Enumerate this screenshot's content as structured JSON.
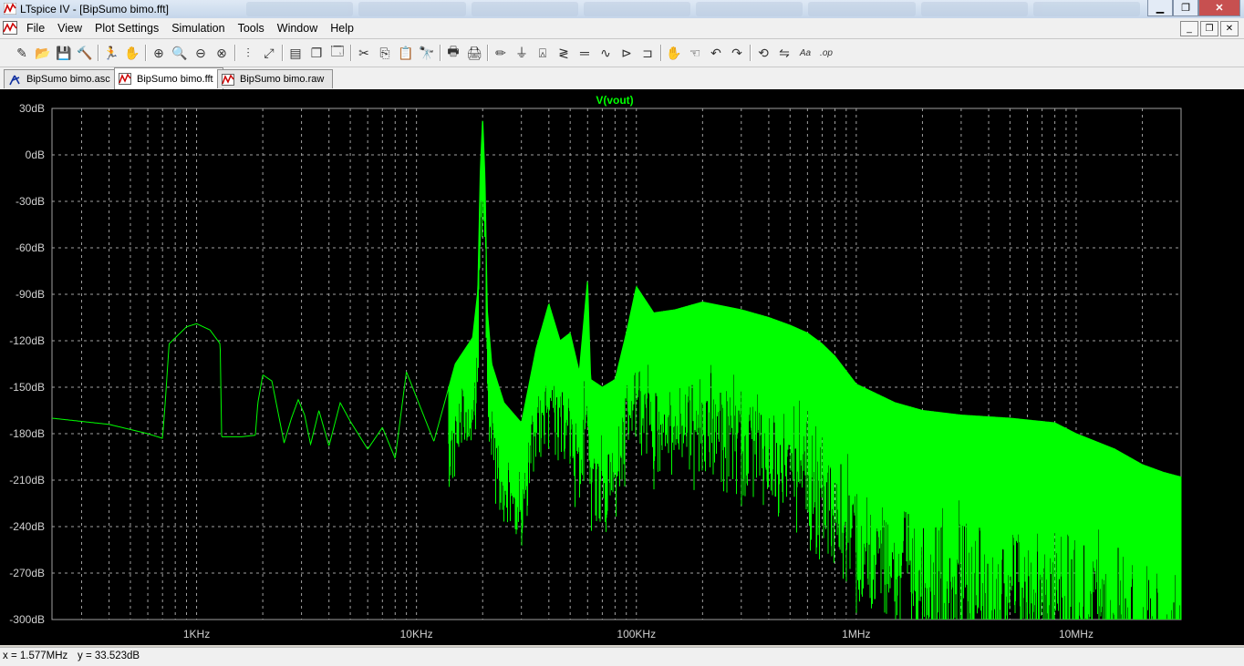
{
  "window": {
    "title": "LTspice IV - [BipSumo bimo.fft]"
  },
  "menu": [
    {
      "label": "File"
    },
    {
      "label": "View"
    },
    {
      "label": "Plot Settings"
    },
    {
      "label": "Simulation"
    },
    {
      "label": "Tools"
    },
    {
      "label": "Window"
    },
    {
      "label": "Help"
    }
  ],
  "toolbar": [
    {
      "name": "new-schematic-button",
      "glyph": "✎"
    },
    {
      "name": "open-button",
      "glyph": "📂"
    },
    {
      "name": "save-button",
      "glyph": "💾"
    },
    {
      "name": "control-panel-button",
      "glyph": "🔨"
    },
    {
      "name": "run-button",
      "glyph": "🏃"
    },
    {
      "name": "halt-button",
      "glyph": "✋"
    },
    {
      "name": "zoom-area-button",
      "glyph": "⊕"
    },
    {
      "name": "pan-button",
      "glyph": "🔍"
    },
    {
      "name": "zoom-out-button",
      "glyph": "⊖"
    },
    {
      "name": "zoom-fit-button",
      "glyph": "⊗"
    },
    {
      "name": "autorange-button",
      "glyph": "⫶"
    },
    {
      "name": "pick-visible-traces-button",
      "glyph": "⤢"
    },
    {
      "name": "tile-horizontal-button",
      "glyph": "▤"
    },
    {
      "name": "cascade-button",
      "glyph": "❐"
    },
    {
      "name": "close-windows-button",
      "glyph": "🗔"
    },
    {
      "name": "cut-button",
      "glyph": "✂"
    },
    {
      "name": "copy-button",
      "glyph": "⎘"
    },
    {
      "name": "paste-button",
      "glyph": "📋"
    },
    {
      "name": "find-button",
      "glyph": "🔭"
    },
    {
      "name": "print-preview-button",
      "glyph": "🖶"
    },
    {
      "name": "print-button",
      "glyph": "🖨"
    },
    {
      "name": "wire-button",
      "glyph": "✏"
    },
    {
      "name": "ground-button",
      "glyph": "⏚"
    },
    {
      "name": "label-net-button",
      "glyph": "⍓"
    },
    {
      "name": "resistor-button",
      "glyph": "≷"
    },
    {
      "name": "capacitor-button",
      "glyph": "═"
    },
    {
      "name": "inductor-button",
      "glyph": "∿"
    },
    {
      "name": "diode-button",
      "glyph": "⊳"
    },
    {
      "name": "component-button",
      "glyph": "⊐"
    },
    {
      "name": "move-button",
      "glyph": "✋"
    },
    {
      "name": "drag-button",
      "glyph": "☜"
    },
    {
      "name": "undo-button",
      "glyph": "↶"
    },
    {
      "name": "redo-button",
      "glyph": "↷"
    },
    {
      "name": "rotate-button",
      "glyph": "⟲"
    },
    {
      "name": "mirror-button",
      "glyph": "⇋"
    },
    {
      "name": "text-button",
      "glyph": "Aa"
    },
    {
      "name": "spice-directive-button",
      "glyph": ".op"
    }
  ],
  "tabs": [
    {
      "label": "BipSumo bimo.asc",
      "active": false,
      "kind": "schematic"
    },
    {
      "label": "BipSumo bimo.fft",
      "active": true,
      "kind": "waveform"
    },
    {
      "label": "BipSumo bimo.raw",
      "active": false,
      "kind": "waveform"
    }
  ],
  "status": {
    "x_readout": "x = 1.577MHz",
    "y_readout": "y = 33.523dB"
  },
  "colors": {
    "trace": "#00ff00",
    "plot_bg": "#000000",
    "grid": "#a0a0a0",
    "axis_text": "#d0d0d0"
  },
  "chart_data": {
    "type": "line",
    "title": "V(vout)",
    "xscale": "log",
    "xlim": [
      220,
      30000000
    ],
    "ylim": [
      -300,
      30
    ],
    "grid": true,
    "x_ticks": [
      {
        "v": 1000,
        "label": "1KHz"
      },
      {
        "v": 10000,
        "label": "10KHz"
      },
      {
        "v": 100000,
        "label": "100KHz"
      },
      {
        "v": 1000000,
        "label": "1MHz"
      },
      {
        "v": 10000000,
        "label": "10MHz"
      }
    ],
    "y_ticks": [
      {
        "v": 30,
        "label": "30dB"
      },
      {
        "v": 0,
        "label": "0dB"
      },
      {
        "v": -30,
        "label": "-30dB"
      },
      {
        "v": -60,
        "label": "-60dB"
      },
      {
        "v": -90,
        "label": "-90dB"
      },
      {
        "v": -120,
        "label": "-120dB"
      },
      {
        "v": -150,
        "label": "-150dB"
      },
      {
        "v": -180,
        "label": "-180dB"
      },
      {
        "v": -210,
        "label": "-210dB"
      },
      {
        "v": -240,
        "label": "-240dB"
      },
      {
        "v": -270,
        "label": "-270dB"
      },
      {
        "v": -300,
        "label": "-300dB"
      }
    ],
    "series": [
      {
        "name": "V(vout)",
        "x": [
          220,
          400,
          600,
          700,
          720,
          750,
          900,
          1000,
          1150,
          1280,
          1300,
          1600,
          1850,
          1900,
          2000,
          2200,
          2500,
          2700,
          2900,
          3100,
          3300,
          3600,
          4000,
          4500,
          5000,
          6000,
          7000,
          8000,
          9000,
          12000,
          15000,
          18000,
          19000,
          19500,
          20000,
          20500,
          21000,
          22000,
          25000,
          30000,
          35000,
          40000,
          45000,
          50000,
          55000,
          60000,
          62000,
          70000,
          80000,
          90000,
          100000,
          120000,
          150000,
          200000,
          300000,
          400000,
          500000,
          600000,
          700000,
          800000,
          1000000,
          1500000,
          2000000,
          3000000,
          5000000,
          8000000,
          10000000,
          15000000,
          20000000,
          25000000,
          30000000
        ],
        "y": [
          -170,
          -174,
          -180,
          -183,
          -160,
          -122,
          -111,
          -109,
          -113,
          -122,
          -182,
          -182,
          -181,
          -160,
          -142,
          -146,
          -186,
          -170,
          -158,
          -168,
          -187,
          -165,
          -188,
          -160,
          -172,
          -190,
          -176,
          -196,
          -140,
          -185,
          -135,
          -118,
          -88,
          -10,
          25,
          -15,
          -100,
          -135,
          -160,
          -173,
          -125,
          -96,
          -120,
          -115,
          -140,
          -80,
          -145,
          -150,
          -145,
          -115,
          -85,
          -102,
          -100,
          -95,
          -100,
          -105,
          -110,
          -115,
          -122,
          -130,
          -148,
          -160,
          -165,
          -168,
          -170,
          -173,
          -180,
          -190,
          -200,
          -205,
          -208
        ]
      }
    ]
  }
}
